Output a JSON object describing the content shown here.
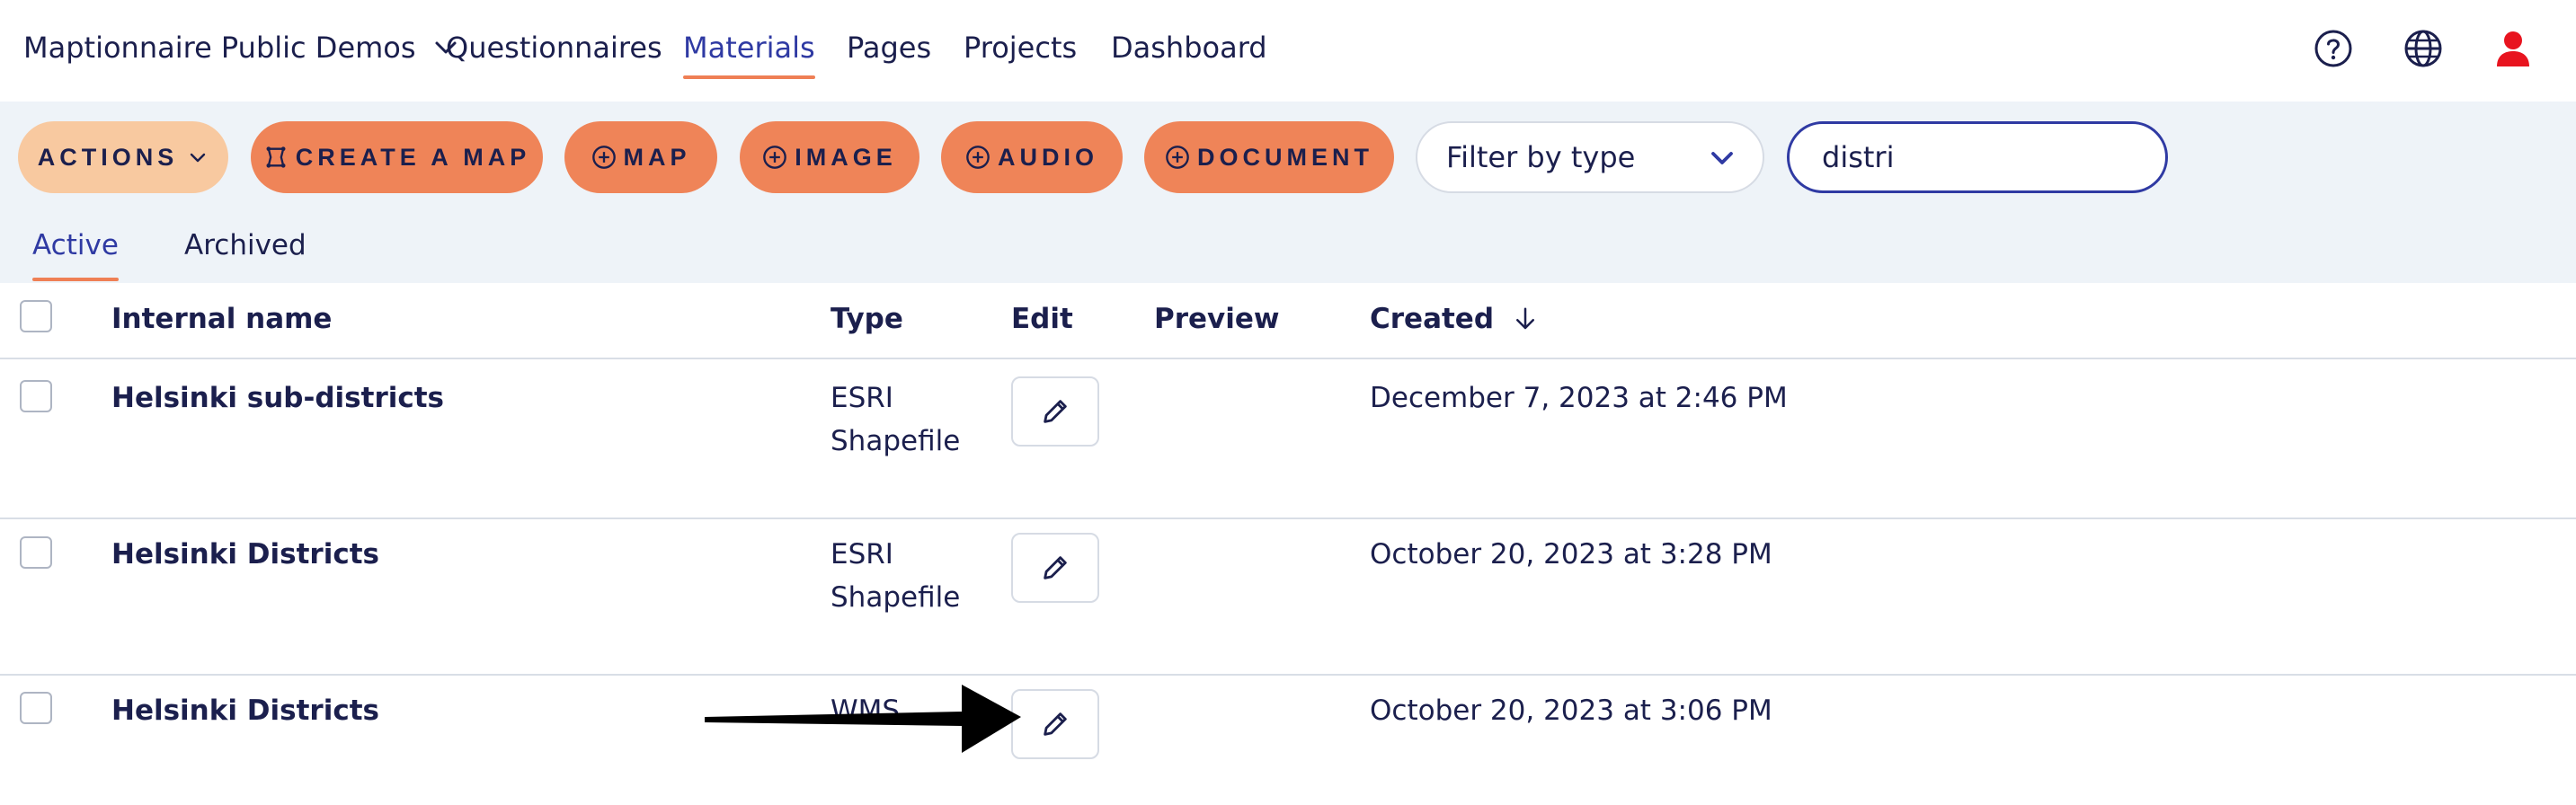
{
  "nav": {
    "org": "Maptionnaire Public Demos",
    "links": [
      "Questionnaires",
      "Materials",
      "Pages",
      "Projects",
      "Dashboard"
    ],
    "active": "Materials",
    "icons": [
      "help-icon",
      "globe-icon",
      "user-icon"
    ]
  },
  "toolbar": {
    "actions": "ACTIONS",
    "create_map": "CREATE A MAP",
    "map": "MAP",
    "image": "IMAGE",
    "audio": "AUDIO",
    "document": "DOCUMENT",
    "filter_value": "Filter by type",
    "search_value": "distri"
  },
  "tabs": [
    "Active",
    "Archived"
  ],
  "table": {
    "headers": {
      "name": "Internal name",
      "type": "Type",
      "edit": "Edit",
      "preview": "Preview",
      "created": "Created"
    },
    "sort_icon": "arrow-down-icon",
    "rows": [
      {
        "name": "Helsinki sub-districts",
        "type_line1": "ESRI",
        "type_line2": "Shapefile",
        "created": "December 7, 2023 at 2:46 PM"
      },
      {
        "name": "Helsinki Districts",
        "type_line1": "ESRI",
        "type_line2": "Shapefile",
        "created": "October 20, 2023 at 3:28 PM"
      },
      {
        "name": "Helsinki Districts",
        "type_line1": "WMS",
        "type_line2": "",
        "created": "October 20, 2023 at 3:06 PM"
      }
    ]
  },
  "colors": {
    "accent": "#2f3aa3",
    "orange": "#ef8458",
    "peach": "#f8c9a0",
    "band": "#eef3f8",
    "user": "#e8141f"
  }
}
